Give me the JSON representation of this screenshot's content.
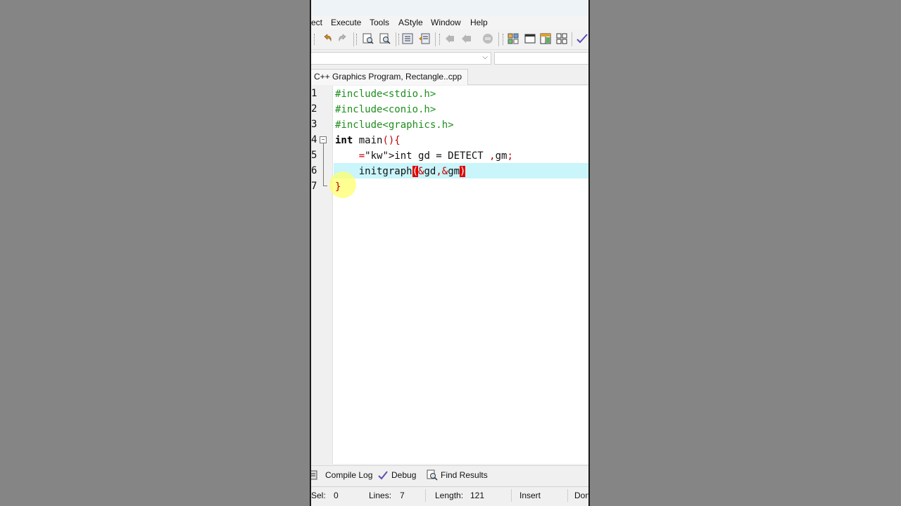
{
  "menu": [
    "ect",
    "Execute",
    "Tools",
    "AStyle",
    "Window",
    "Help"
  ],
  "toolbar_icons": [
    "undo-icon",
    "redo-icon",
    "find-icon",
    "replace-icon",
    "indent-icon",
    "unindent-icon",
    "back-icon",
    "forward-icon",
    "bookmark-icon",
    "new-class-icon",
    "window-icon",
    "project-options-icon",
    "grid-icon",
    "check-icon"
  ],
  "tab": {
    "label": "C++ Graphics Program, Rectangle..cpp"
  },
  "editor": {
    "line_numbers": [
      "1",
      "2",
      "3",
      "4",
      "5",
      "6",
      "7"
    ],
    "lines": [
      "#include<stdio.h>",
      "#include<conio.h>",
      "#include<graphics.h>",
      "int main(){",
      "    int gd = DETECT ,gm;",
      "    initgraph(&gd,&gm)",
      "}"
    ],
    "current_line": 6,
    "highlight_color": "#c9f5fb",
    "preprocessor_color": "#1f8f1f",
    "symbol_color": "#c00000"
  },
  "bottom_tabs": {
    "compile_log": "Compile Log",
    "debug": "Debug",
    "find_results": "Find Results"
  },
  "status": {
    "sel_label": "Sel:",
    "sel_value": "0",
    "lines_label": "Lines:",
    "lines_value": "7",
    "length_label": "Length:",
    "length_value": "121",
    "mode": "Insert",
    "done": "Don"
  }
}
